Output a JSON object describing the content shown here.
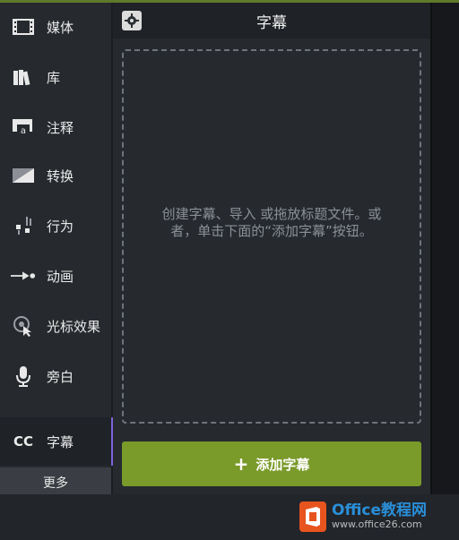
{
  "sidebar": {
    "items": [
      {
        "label": "媒体",
        "icon": "film-icon"
      },
      {
        "label": "库",
        "icon": "library-icon"
      },
      {
        "label": "注释",
        "icon": "annotation-icon"
      },
      {
        "label": "转换",
        "icon": "transition-icon"
      },
      {
        "label": "行为",
        "icon": "behavior-icon"
      },
      {
        "label": "动画",
        "icon": "animation-icon"
      },
      {
        "label": "光标效果",
        "icon": "cursor-effect-icon"
      },
      {
        "label": "旁白",
        "icon": "microphone-icon"
      },
      {
        "label": "字幕",
        "icon": "cc-icon",
        "badge": "CC"
      }
    ],
    "more_label": "更多"
  },
  "panel": {
    "title": "字幕",
    "drop_text": "创建字幕、导入 或拖放标题文件。或者，单击下面的“添加字幕”按钮。",
    "add_button": {
      "plus": "+",
      "label": "添加字幕"
    }
  },
  "watermark": {
    "brand": "Office教程网",
    "url": "www.office26.com"
  },
  "colors": {
    "accent_green": "#7a9a2a",
    "active_indicator": "#7e62d9",
    "logo_orange": "#e8541e",
    "brand_blue": "#2a8fd8"
  }
}
